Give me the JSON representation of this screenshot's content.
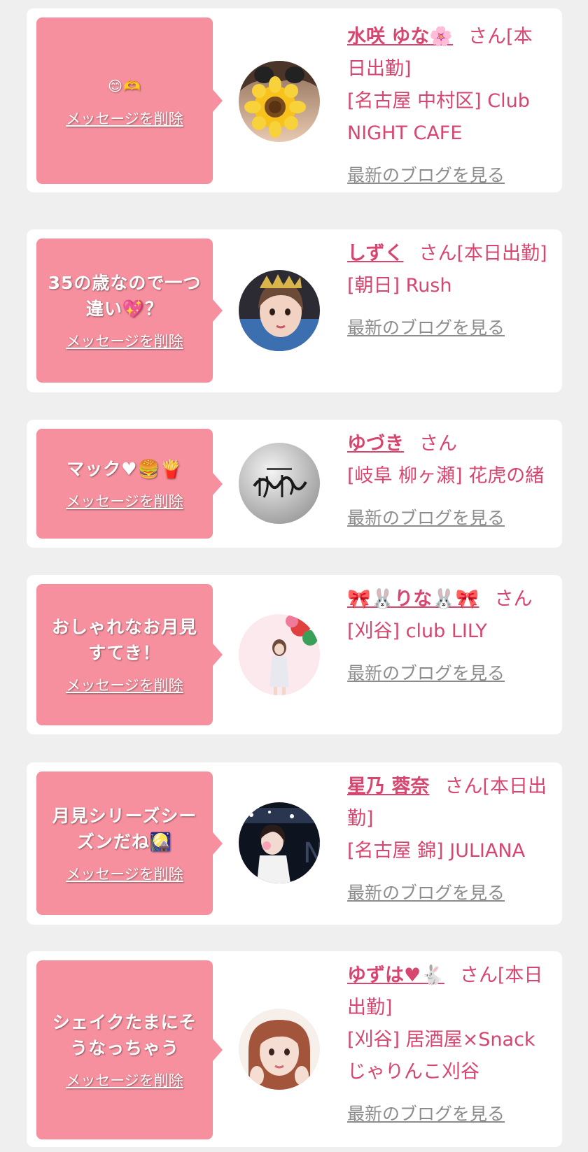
{
  "delete_label": "メッセージを削除",
  "blog_label": "最新のブログを見る",
  "san_label": "さん",
  "items": [
    {
      "message": "😊🫶",
      "name": "水咲 ゆな🌸",
      "status": "[本日出勤]",
      "shop": "[名古屋 中村区] Club NIGHT CAFE",
      "avatar": "sunflower-sticker-photo"
    },
    {
      "message": "35の歳なので一つ違い💖？",
      "name": "しずく",
      "status": "[本日出勤]",
      "shop": "[朝日] Rush",
      "avatar": "crown-selfie-photo"
    },
    {
      "message": "マック♥🍔🍟",
      "name": "ゆづき",
      "status": "",
      "shop": "[岐阜 柳ヶ瀬] 花虎の緒",
      "avatar": "shop-logo"
    },
    {
      "message": "おしゃれなお月見すてき！",
      "name": "🎀🐰りな🐰🎀",
      "status": "",
      "shop": "[刈谷] club LILY",
      "avatar": "balloon-photo"
    },
    {
      "message": "月見シリーズシーズンだね🎑",
      "name": "星乃 蓉奈",
      "status": "[本日出勤]",
      "shop": "[名古屋 錦] JULIANA",
      "avatar": "night-photo"
    },
    {
      "message": "シェイクたまにそうなっちゃう",
      "name": "ゆずは♥🐇",
      "status": "[本日出勤]",
      "shop": "[刈谷] 居酒屋×Snack じゃりんこ刈谷",
      "avatar": "portrait-photo"
    }
  ]
}
